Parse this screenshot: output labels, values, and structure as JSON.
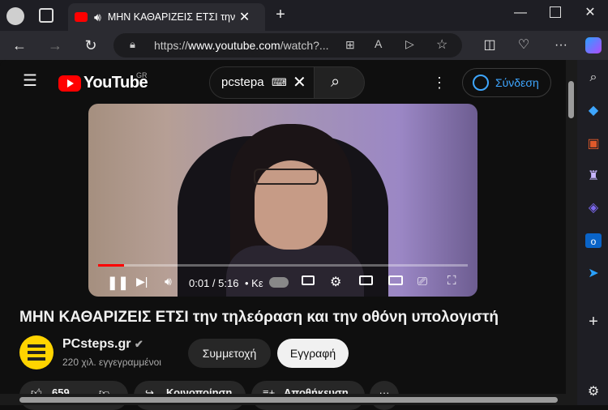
{
  "browser": {
    "tab_title": "ΜΗΝ ΚΑΘΑΡΙΖΕΙΣ ΕΤΣΙ την",
    "url_prefix": "https://",
    "url_host": "www.youtube.com",
    "url_path": "/watch?..."
  },
  "youtube": {
    "logo_text": "YouTube",
    "region": "GR",
    "search_value": "pcstepa",
    "signin_label": "Σύνδεση"
  },
  "player": {
    "time": "0:01 / 5:16",
    "chapter": "• Κε",
    "progress_fraction": 0.07
  },
  "video": {
    "title": "ΜΗΝ ΚΑΘΑΡΙΖΕΙΣ ΕΤΣΙ την τηλεόραση και την οθόνη υπολογιστή",
    "channel": "PCsteps.gr",
    "subscribers": "220 χιλ. εγγεγραμμένοι",
    "join_label": "Συμμετοχή",
    "subscribe_label": "Εγγραφή",
    "likes": "659",
    "share_label": "Κοινοποίηση",
    "save_label": "Αποθήκευση"
  },
  "colors": {
    "accent": "#3ea6ff",
    "brand": "#ff0000",
    "channel_avatar": "#ffd400"
  }
}
